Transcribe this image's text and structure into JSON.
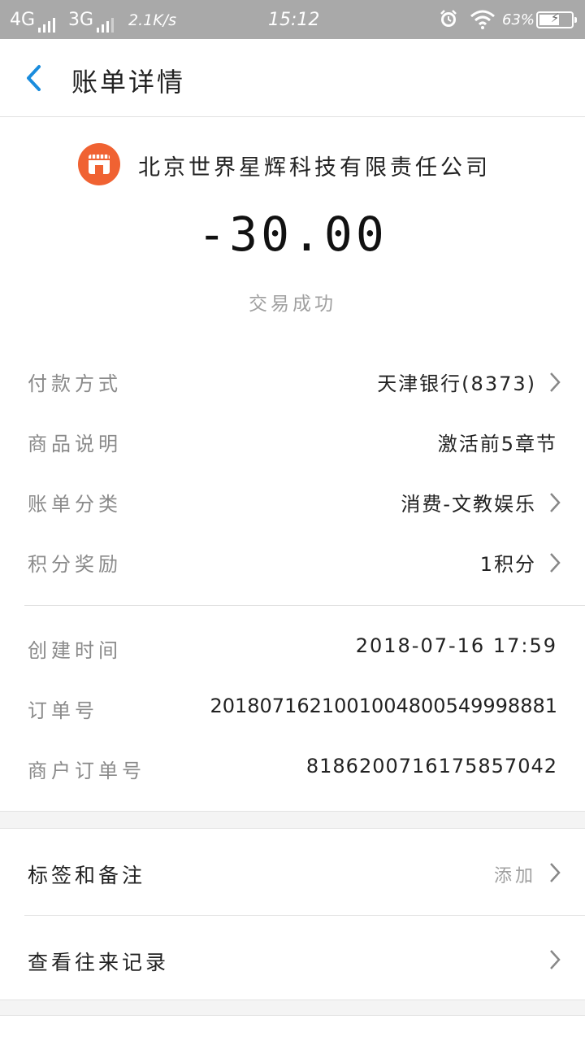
{
  "statusbar": {
    "sim1": "4G",
    "sim2": "3G",
    "net_speed": "2.1K/s",
    "time": "15:12",
    "battery_text": "63%",
    "battery_level": 0.63
  },
  "header": {
    "title": "账单详情"
  },
  "bill": {
    "merchant": "北京世界星辉科技有限责任公司",
    "amount": "-30.00",
    "status": "交易成功"
  },
  "details": [
    {
      "label": "付款方式",
      "value": "天津银行(8373)"
    },
    {
      "label": "商品说明",
      "value": "激活前5章节"
    },
    {
      "label": "账单分类",
      "value": "消费-文教娱乐"
    },
    {
      "label": "积分奖励",
      "value": "1积分"
    }
  ],
  "info": [
    {
      "label": "创建时间",
      "value": "2018-07-16 17:59"
    },
    {
      "label": "订单号",
      "value": "2018071621001004800549998881"
    },
    {
      "label": "商户订单号",
      "value": "8186200716175857042"
    }
  ],
  "extras": {
    "tags_label": "标签和备注",
    "tags_action": "添加",
    "history_label": "查看往来记录"
  },
  "colors": {
    "accent": "#1a8cdd",
    "shop_icon": "#f06232"
  }
}
